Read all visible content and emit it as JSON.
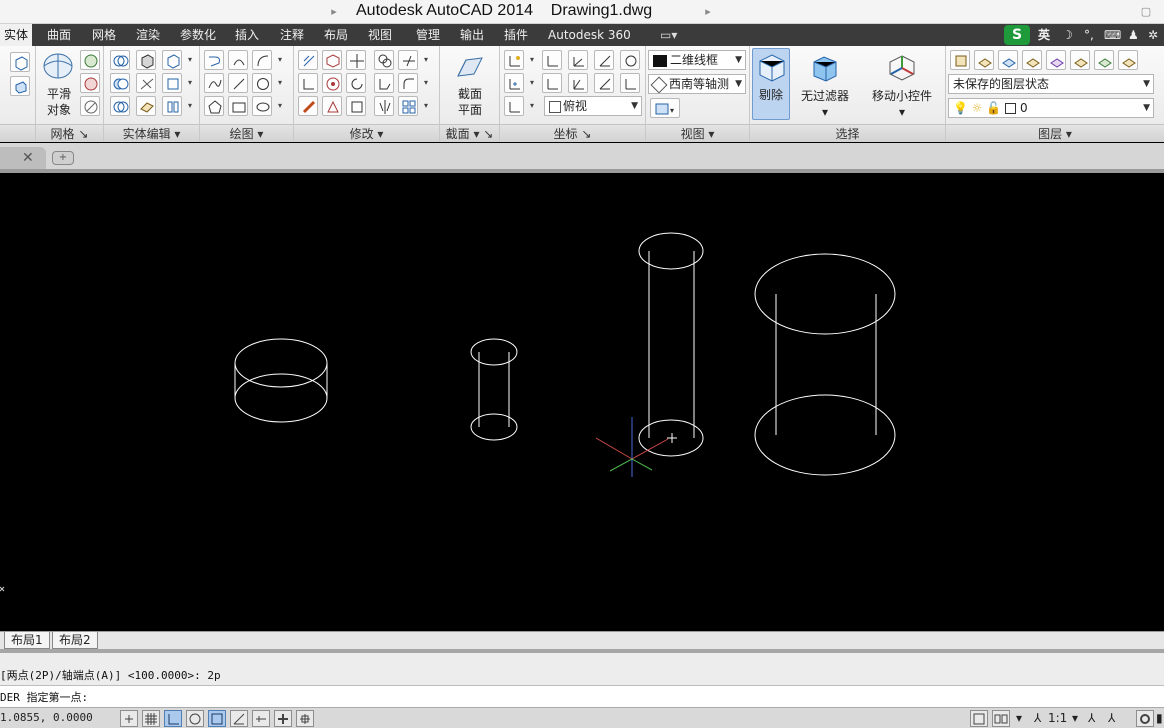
{
  "window": {
    "app_title": "Autodesk AutoCAD 2014",
    "file_name": "Drawing1.dwg"
  },
  "ribbon_tabs": [
    {
      "label": "实体",
      "active": true
    },
    {
      "label": "曲面"
    },
    {
      "label": "网格"
    },
    {
      "label": "渲染"
    },
    {
      "label": "参数化"
    },
    {
      "label": "插入"
    },
    {
      "label": "注释"
    },
    {
      "label": "布局"
    },
    {
      "label": "视图"
    },
    {
      "label": "管理"
    },
    {
      "label": "输出"
    },
    {
      "label": "插件"
    },
    {
      "label": "Autodesk 360"
    }
  ],
  "tray": {
    "ime_label": "英"
  },
  "ribbon": {
    "smooth_object_label_1": "平滑",
    "smooth_object_label_2": "对象",
    "section_plane_label_1": "截面",
    "section_plane_label_2": "平面",
    "visual_style": "二维线框",
    "view_preset": "西南等轴测",
    "ucs_view": "俯视",
    "cull_label": "剔除",
    "no_filter_label": "无过滤器",
    "gizmo_label": "移动小控件",
    "layer_state": "未保存的图层状态",
    "current_layer": "0",
    "panels": {
      "mesh": "网格",
      "solid_edit": "实体编辑",
      "draw": "绘图",
      "modify": "修改",
      "section": "截面",
      "coordinates": "坐标",
      "view": "视图",
      "selection": "选择",
      "layers": "图层"
    }
  },
  "layout_tabs": [
    "布局1",
    "布局2"
  ],
  "command": {
    "history": "[两点(2P)/轴端点(A)] <100.0000>: 2p",
    "prompt": "DER 指定第一点:"
  },
  "status": {
    "coords": "1.0855, 0.0000",
    "annotation_scale": "1:1"
  },
  "colors": {
    "ucs_x": "#d24a4a",
    "ucs_y": "#4ab44a",
    "ucs_z": "#4a6ad2",
    "wire": "#ffffff"
  }
}
